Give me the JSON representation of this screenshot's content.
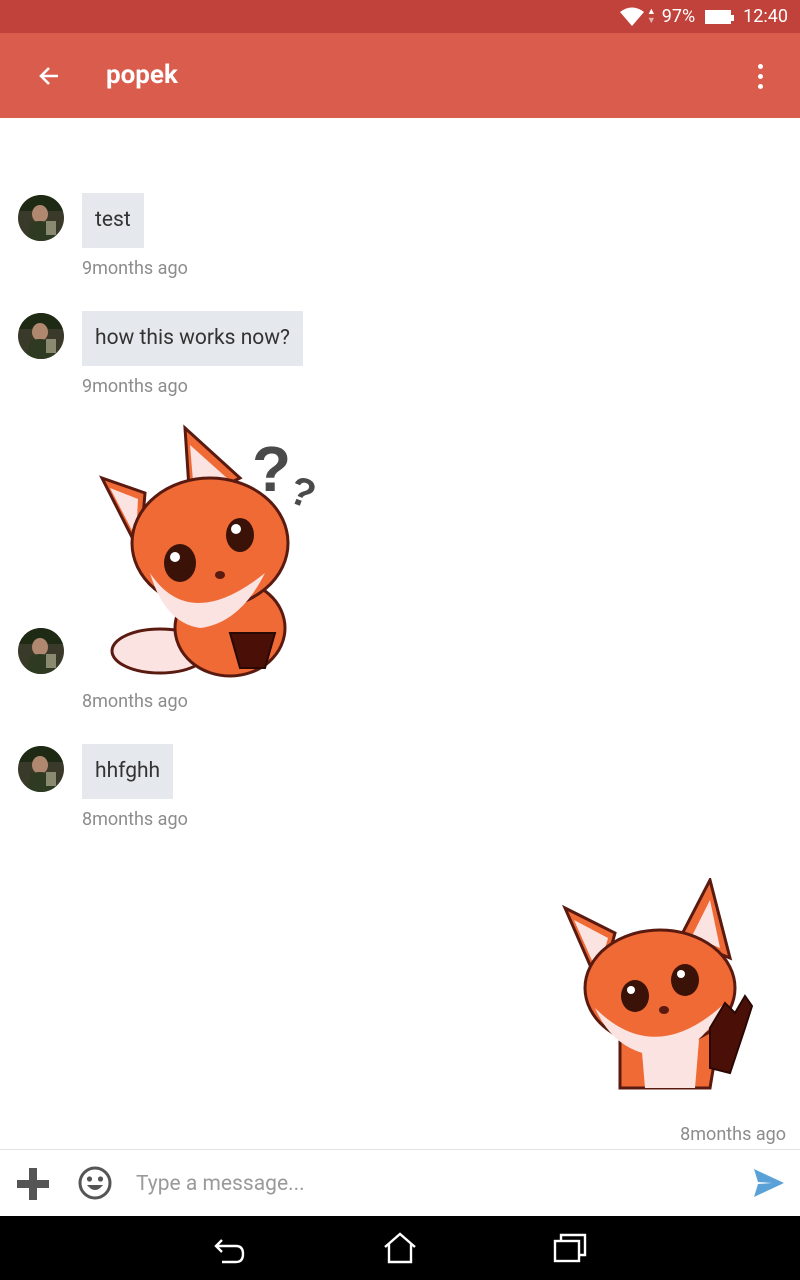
{
  "status_bar": {
    "battery_percent": "97%",
    "time": "12:40"
  },
  "app_bar": {
    "title": "popek"
  },
  "messages": [
    {
      "type": "text",
      "direction": "incoming",
      "text": "test",
      "time": "9months ago"
    },
    {
      "type": "text",
      "direction": "incoming",
      "text": "how this works now?",
      "time": "9months ago"
    },
    {
      "type": "sticker",
      "direction": "incoming",
      "sticker": "fox-question-sticker",
      "time": "8months ago"
    },
    {
      "type": "text",
      "direction": "incoming",
      "text": "hhfghh",
      "time": "8months ago"
    },
    {
      "type": "sticker",
      "direction": "outgoing",
      "sticker": "fox-wave-sticker",
      "time": "8months ago"
    }
  ],
  "composer": {
    "placeholder": "Type a message..."
  },
  "icons": {
    "back": "arrow-left-icon",
    "more": "more-vert-icon",
    "add": "plus-icon",
    "emoji": "smile-icon",
    "send": "send-icon",
    "nav_back": "nav-back-icon",
    "nav_home": "nav-home-icon",
    "nav_recents": "nav-recents-icon"
  },
  "colors": {
    "status_bar": "#c0423a",
    "app_bar": "#d95c4d",
    "bubble": "#e5e8ec",
    "send": "#5aa1d8"
  }
}
